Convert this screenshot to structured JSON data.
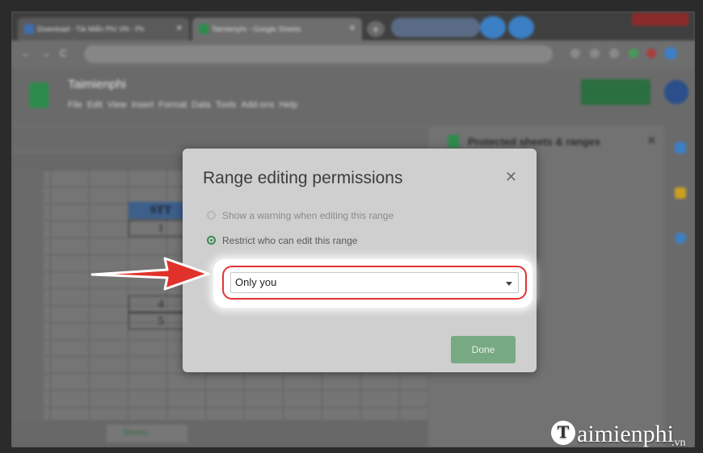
{
  "browser": {
    "tabs": [
      {
        "label": "Download - Tải Miễn Phí VN - Ph",
        "favicon_color": "#3d6fb0"
      },
      {
        "label": "Taimienphi - Google Sheets",
        "favicon_color": "#2e8b4e"
      }
    ]
  },
  "sheets": {
    "title": "Taimienphi",
    "stt_header": "STT",
    "row_numbers": [
      "1",
      "4",
      "5"
    ],
    "side_panel_title": "Protected sheets & ranges",
    "sheet_tab": "Sheet1"
  },
  "dialog": {
    "title": "Range editing permissions",
    "options": [
      {
        "label": "Show a warning when editing this range",
        "selected": false
      },
      {
        "label": "Restrict who can edit this range",
        "selected": true
      }
    ],
    "select_value": "Only you",
    "done_label": "Done"
  },
  "colors": {
    "accent_green": "#3b8a50",
    "highlight_red": "#e03434",
    "arrow_red": "#e0322a"
  },
  "watermark": {
    "brand": "aimienphi",
    "suffix": ".vn"
  }
}
